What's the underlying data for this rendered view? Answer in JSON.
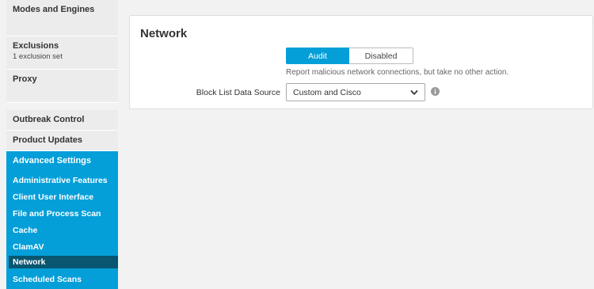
{
  "sidebar": {
    "modes_engines": "Modes and Engines",
    "exclusions": {
      "title": "Exclusions",
      "subtitle": "1 exclusion set"
    },
    "proxy": "Proxy",
    "outbreak_control": "Outbreak Control",
    "product_updates": "Product Updates",
    "advanced_settings": {
      "title": "Advanced Settings",
      "items": [
        "Administrative Features",
        "Client User Interface",
        "File and Process Scan",
        "Cache",
        "ClamAV",
        "Network",
        "Scheduled Scans"
      ],
      "active_item": "Network"
    }
  },
  "main": {
    "title": "Network",
    "mode": {
      "options": [
        "Audit",
        "Disabled"
      ],
      "selected": "Audit",
      "description": "Report malicious network connections, but take no other action."
    },
    "block_list": {
      "label": "Block List Data Source",
      "value": "Custom and Cisco"
    }
  },
  "colors": {
    "accent": "#049fd9",
    "active_item_bg": "#085670",
    "sidebar_bg": "#ececec",
    "page_bg": "#f2f2f2"
  },
  "icons": {
    "select_arrow": "chevron-down-icon",
    "info": "info-icon"
  }
}
